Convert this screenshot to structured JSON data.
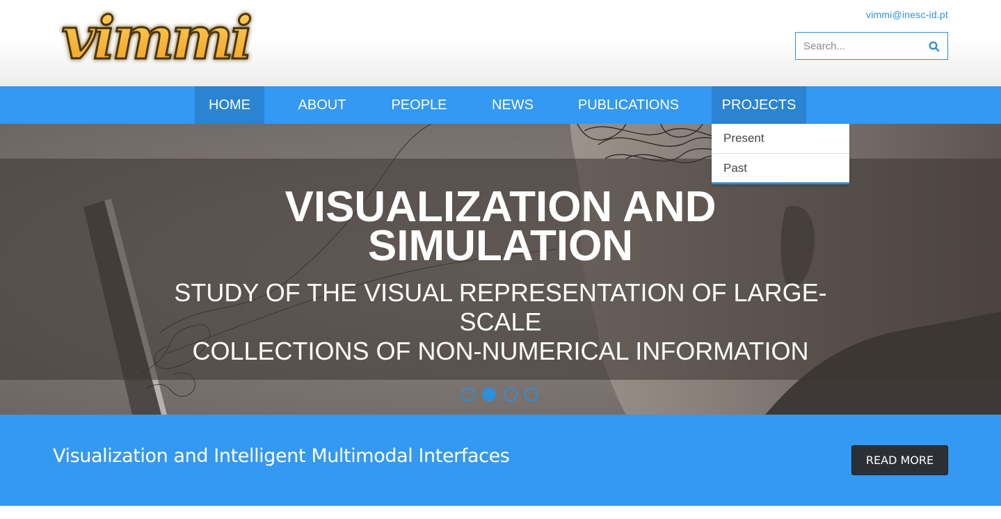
{
  "header": {
    "logo_text": "vimmi",
    "email": "vimmi@inesc-id.pt",
    "search": {
      "placeholder": "Search..."
    }
  },
  "nav": {
    "items": [
      {
        "label": "HOME"
      },
      {
        "label": "ABOUT"
      },
      {
        "label": "PEOPLE"
      },
      {
        "label": "NEWS"
      },
      {
        "label": "PUBLICATIONS"
      },
      {
        "label": "PROJECTS"
      }
    ],
    "active": "HOME",
    "open_menu": "PROJECTS"
  },
  "dropdown": {
    "items": [
      {
        "label": "Present"
      },
      {
        "label": "Past"
      }
    ]
  },
  "hero": {
    "title_line1": "VISUALIZATION AND",
    "title_line2": "SIMULATION",
    "subtitle_line1": "STUDY OF THE VISUAL REPRESENTATION OF LARGE-SCALE",
    "subtitle_line2": "COLLECTIONS OF NON-NUMERICAL INFORMATION",
    "slides": 4,
    "active_slide": 2
  },
  "band": {
    "text": "Visualization and Intelligent Multimodal Interfaces",
    "button_label": "READ MORE"
  },
  "colors": {
    "accent": "#3399f3",
    "accent_dark": "#2f8fd8",
    "button_dark": "#2c3035",
    "logo_orange": "#f5a623"
  }
}
